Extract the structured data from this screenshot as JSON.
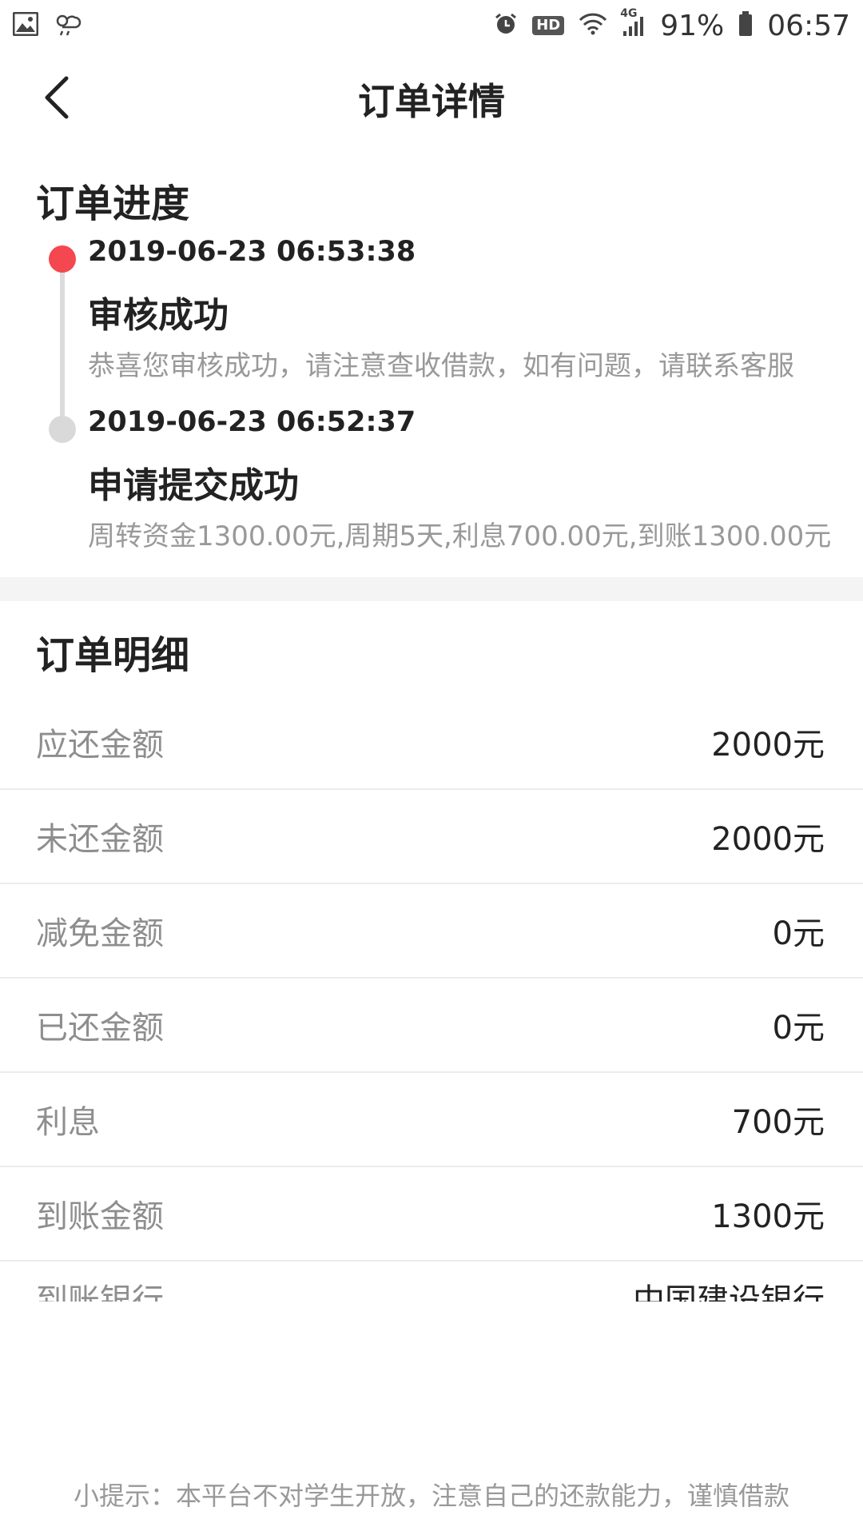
{
  "status_bar": {
    "battery": "91%",
    "time": "06:57",
    "network": "4G",
    "hd_badge": "HD"
  },
  "header": {
    "title": "订单详情",
    "back_icon": "back-arrow-icon"
  },
  "progress": {
    "section_title": "订单进度",
    "events": [
      {
        "time": "2019-06-23 06:53:38",
        "status": "审核成功",
        "description": "恭喜您审核成功，请注意查收借款，如有问题，请联系客服",
        "dot_color": "#f5474f"
      },
      {
        "time": "2019-06-23 06:52:37",
        "status": "申请提交成功",
        "description": "周转资金1300.00元,周期5天,利息700.00元,到账1300.00元",
        "dot_color": "#d9d9d9"
      }
    ]
  },
  "details": {
    "section_title": "订单明细",
    "rows": [
      {
        "label": "应还金额",
        "value": "2000元"
      },
      {
        "label": "未还金额",
        "value": "2000元"
      },
      {
        "label": "减免金额",
        "value": "0元"
      },
      {
        "label": "已还金额",
        "value": "0元"
      },
      {
        "label": "利息",
        "value": "700元"
      },
      {
        "label": "到账金额",
        "value": "1300元"
      },
      {
        "label": "到账银行",
        "value": "中国建设银行"
      }
    ]
  },
  "footer": {
    "tip": "小提示：本平台不对学生开放，注意自己的还款能力，谨慎借款"
  }
}
